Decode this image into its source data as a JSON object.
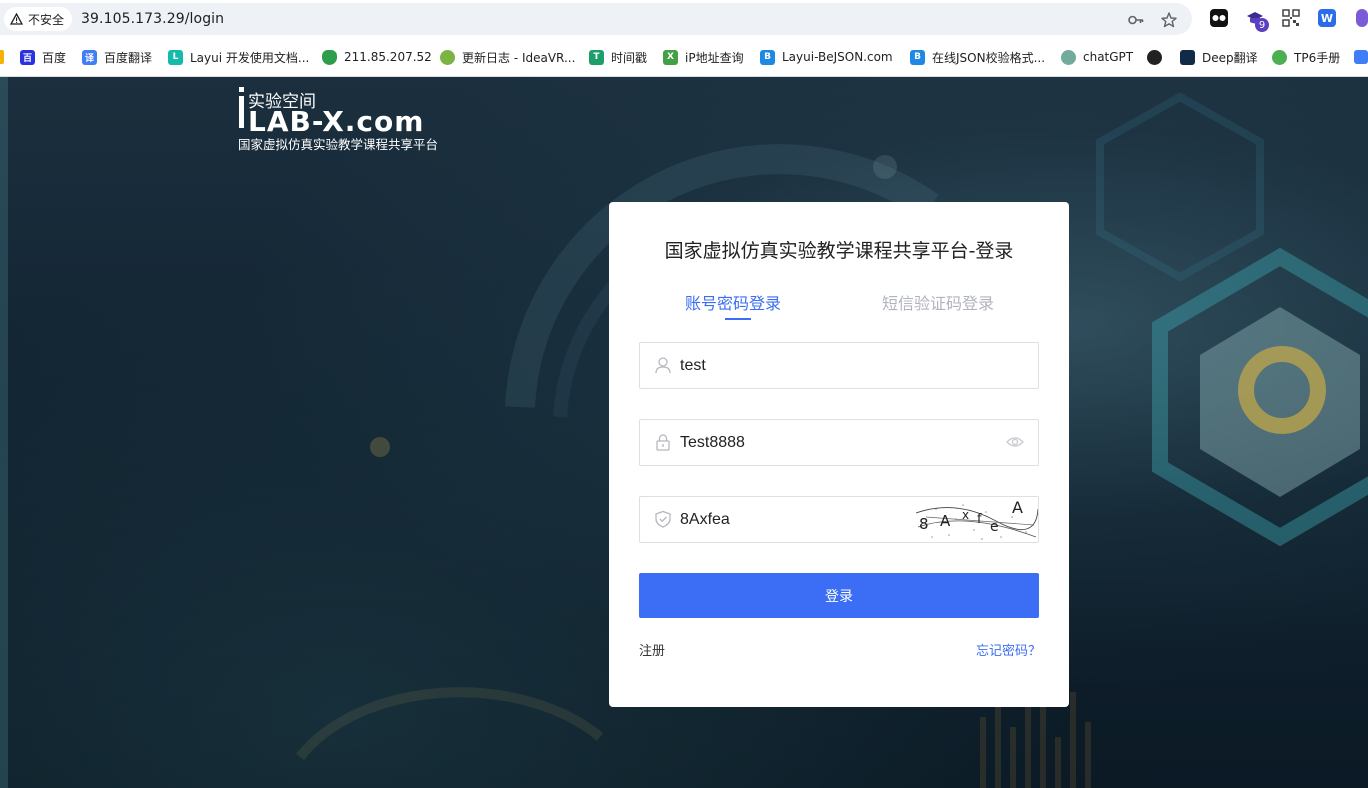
{
  "browser": {
    "security_label": "不安全",
    "url": "39.105.173.29/login",
    "extension_badge": "9"
  },
  "bookmarks": [
    {
      "label": "百度",
      "icon": "baidu-icon",
      "color": "#2932e1"
    },
    {
      "label": "百度翻译",
      "icon": "translate-icon",
      "color": "#3f7ef5"
    },
    {
      "label": "Layui 开发使用文档...",
      "icon": "layui-icon",
      "color": "#16baaa"
    },
    {
      "label": "211.85.207.52",
      "icon": "shield-green-icon",
      "color": "#2e9d4c"
    },
    {
      "label": "更新日志 - IdeaVR...",
      "icon": "ideavr-icon",
      "color": "#7cb342"
    },
    {
      "label": "时间戳",
      "icon": "timestamp-icon",
      "color": "#1e9e6a"
    },
    {
      "label": "iP地址查询",
      "icon": "ip-icon",
      "color": "#43a047"
    },
    {
      "label": "Layui-BeJSON.com",
      "icon": "bejson-icon",
      "color": "#1e88e5"
    },
    {
      "label": "在线JSON校验格式...",
      "icon": "json-icon",
      "color": "#1e88e5"
    },
    {
      "label": "chatGPT",
      "icon": "chatgpt-icon",
      "color": "#74aa9c"
    },
    {
      "label": "",
      "icon": "globe-icon",
      "color": "#222222"
    },
    {
      "label": "Deep翻译",
      "icon": "deepl-icon",
      "color": "#0f2b46"
    },
    {
      "label": "TP6手册",
      "icon": "tp6-icon",
      "color": "#4caf50"
    }
  ],
  "logo": {
    "top_text": "实验空间",
    "main_text": "LAB-X.com",
    "sub_text": "国家虚拟仿真实验教学课程共享平台"
  },
  "login": {
    "title": "国家虚拟仿真实验教学课程共享平台-登录",
    "tab_password": "账号密码登录",
    "tab_sms": "短信验证码登录",
    "username_value": "test",
    "password_value": "Test8888",
    "captcha_value": "8Axfea",
    "captcha_image_text": "8AxfeA",
    "submit_label": "登录",
    "register_link": "注册",
    "forgot_link": "忘记密码？"
  },
  "colors": {
    "accent": "#3b6ef5",
    "inactive_tab": "#b0b4bc"
  }
}
